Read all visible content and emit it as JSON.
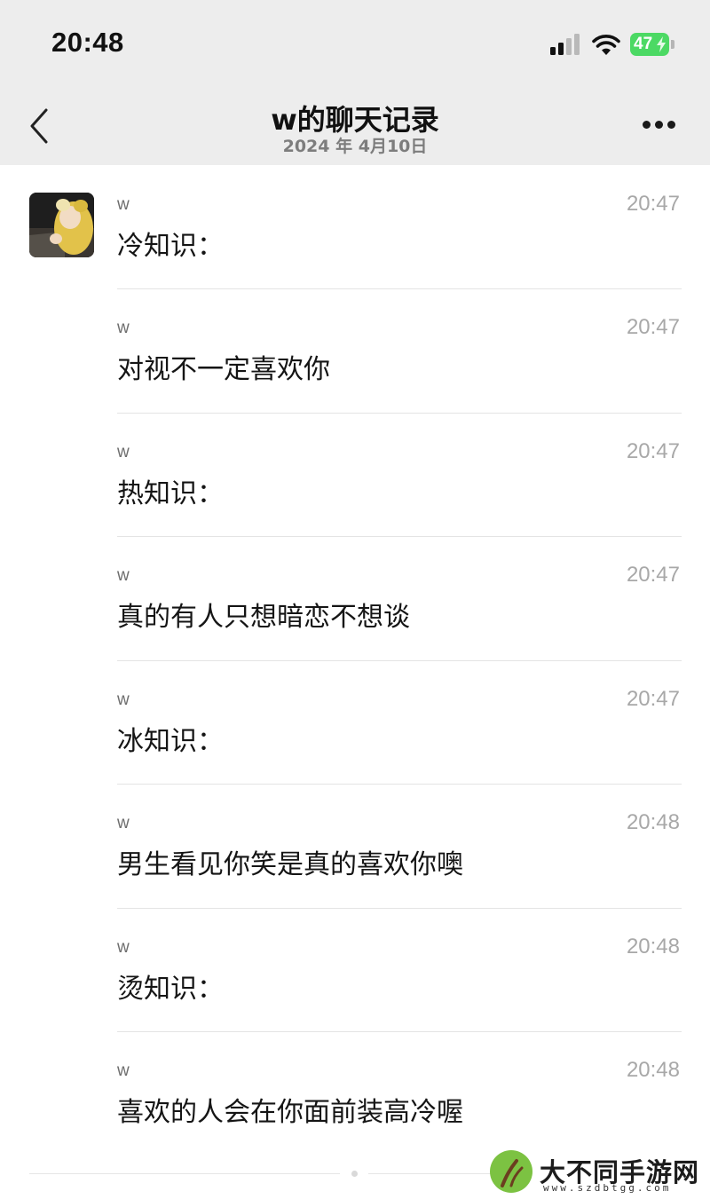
{
  "status_bar": {
    "time": "20:48",
    "battery": "47"
  },
  "nav": {
    "title": "w的聊天记录",
    "subtitle": "2024 年 4月10日"
  },
  "messages": [
    {
      "sender": "w",
      "time": "20:47",
      "text": "冷知识："
    },
    {
      "sender": "w",
      "time": "20:47",
      "text": "对视不一定喜欢你"
    },
    {
      "sender": "w",
      "time": "20:47",
      "text": "热知识："
    },
    {
      "sender": "w",
      "time": "20:47",
      "text": "真的有人只想暗恋不想谈"
    },
    {
      "sender": "w",
      "time": "20:47",
      "text": "冰知识："
    },
    {
      "sender": "w",
      "time": "20:48",
      "text": "男生看见你笑是真的喜欢你噢"
    },
    {
      "sender": "w",
      "time": "20:48",
      "text": "烫知识："
    },
    {
      "sender": "w",
      "time": "20:48",
      "text": "喜欢的人会在你面前装高冷喔"
    }
  ],
  "watermark": {
    "text": "大不同手游网",
    "url": "www.szdbtgg.com"
  },
  "colors": {
    "header_bg": "#ededed",
    "battery_green": "#4cd964",
    "divider": "#e4e4e4"
  }
}
